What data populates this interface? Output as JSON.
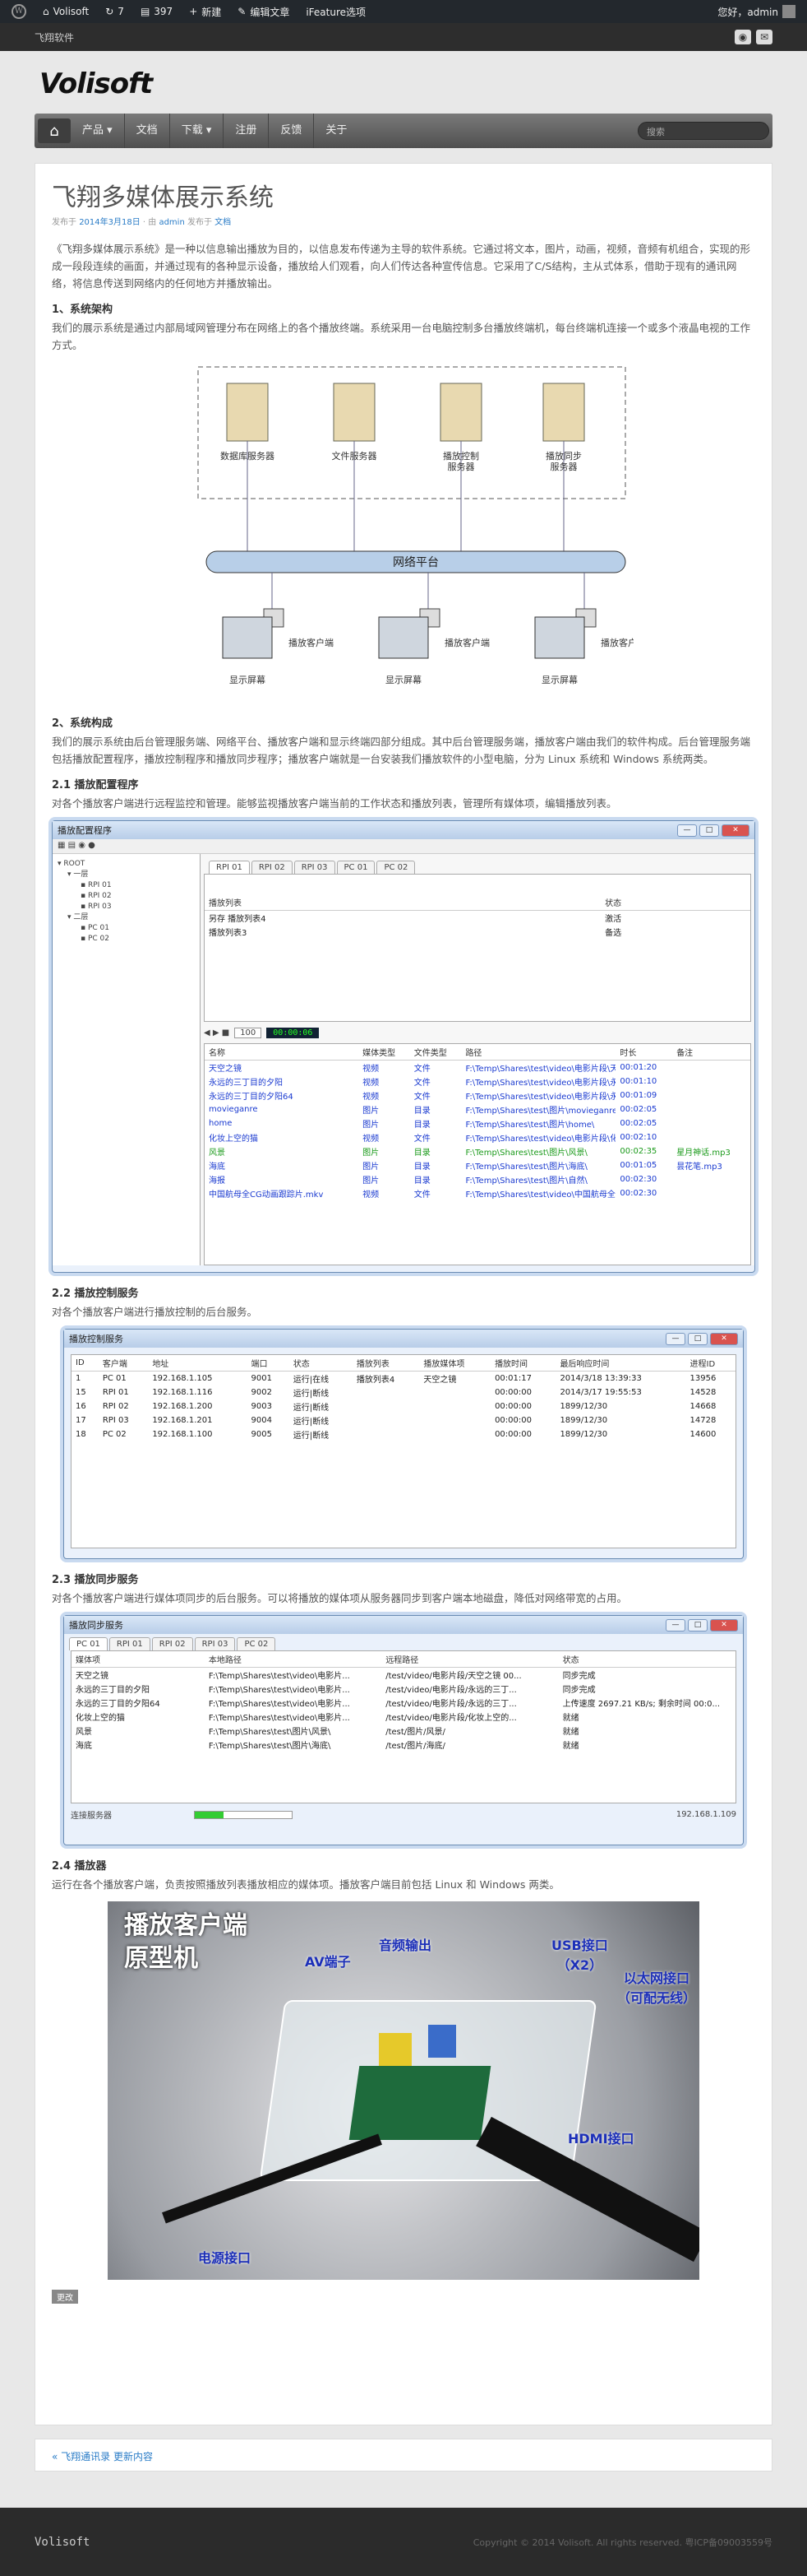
{
  "adminbar": {
    "site": "Volisoft",
    "updates": "7",
    "comments": "397",
    "new": "新建",
    "edit": "编辑文章",
    "ifeature": "iFeature选项",
    "greeting": "您好，admin"
  },
  "topbar": {
    "site_name": "飞翔软件"
  },
  "header": {
    "logo": "Volisoft"
  },
  "nav": {
    "items": [
      "产品 ▾",
      "文档",
      "下载 ▾",
      "注册",
      "反馈",
      "关于"
    ],
    "search_placeholder": "搜索"
  },
  "post": {
    "title": "飞翔多媒体展示系统",
    "meta_prefix": "发布于 ",
    "date": "2014年3月18日",
    "meta_by": " · 由 ",
    "author": "admin",
    "meta_cat": " 发布于 ",
    "category": "文档",
    "intro": "《飞翔多媒体展示系统》是一种以信息输出播放为目的，以信息发布传递为主导的软件系统。它通过将文本，图片，动画，视频，音频有机组合，实现的形成一段段连续的画面，并通过现有的各种显示设备，播放给人们观看，向人们传达各种宣传信息。它采用了C/S结构，主从式体系，借助于现有的通讯网络，将信息传送到网络内的任何地方并播放输出。",
    "s1_title": "1、系统架构",
    "s1_body": "我们的展示系统是通过内部局域网管理分布在网络上的各个播放终端。系统采用一台电脑控制多台播放终端机，每台终端机连接一个或多个液晶电视的工作方式。",
    "s2_title": "2、系统构成",
    "s2_body": "我们的展示系统由后台管理服务端、网络平台、播放客户端和显示终端四部分组成。其中后台管理服务端，播放客户端由我们的软件构成。后台管理服务端包括播放配置程序，播放控制程序和播放同步程序；播放客户端就是一台安装我们播放软件的小型电脑，分为 Linux 系统和 Windows 系统两类。",
    "s21_title": "2.1 播放配置程序",
    "s21_body": "对各个播放客户端进行远程监控和管理。能够监视播放客户端当前的工作状态和播放列表，管理所有媒体项，编辑播放列表。",
    "s22_title": "2.2 播放控制服务",
    "s22_body": "对各个播放客户端进行播放控制的后台服务。",
    "s23_title": "2.3 播放同步服务",
    "s23_body": "对各个播放客户端进行媒体项同步的后台服务。可以将播放的媒体项从服务器同步到客户端本地磁盘，降低对网络带宽的占用。",
    "s24_title": "2.4 播放器",
    "s24_body": "运行在各个播放客户端，负责按照播放列表播放相应的媒体项。播放客户端目前包括 Linux 和 Windows 两类。",
    "tag": "更改"
  },
  "diagram": {
    "servers": [
      "数据库服务器",
      "文件服务器",
      "播放控制\n服务器",
      "播放同步\n服务器"
    ],
    "network": "网络平台",
    "client": "播放客户端",
    "display": "显示屏幕"
  },
  "config_window": {
    "title": "播放配置程序",
    "tree": [
      "ROOT",
      "一层",
      "RPI 01",
      "RPI 02",
      "RPI 03",
      "二层",
      "PC 01",
      "PC 02"
    ],
    "tabs": [
      "RPI 01",
      "RPI 02",
      "RPI 03",
      "PC 01",
      "PC 02"
    ],
    "pl_headers": [
      "播放列表",
      "状态"
    ],
    "playlists": [
      [
        "另存 播放列表4",
        "激活"
      ],
      [
        "播放列表3",
        "备选"
      ]
    ],
    "time": "00:00:06",
    "page": "100",
    "media_headers": [
      "名称",
      "媒体类型",
      "文件类型",
      "路径",
      "时长",
      "备注"
    ],
    "media": [
      [
        "天空之镜",
        "视频",
        "文件",
        "F:\\Temp\\Shares\\test\\video\\电影片段\\天空之镜 00_12...",
        "00:01:20",
        ""
      ],
      [
        "永远的三丁目的夕阳",
        "视频",
        "文件",
        "F:\\Temp\\Shares\\test\\video\\电影片段\\永远的三丁目的...",
        "00:01:10",
        ""
      ],
      [
        "永远的三丁目的夕阳64",
        "视频",
        "文件",
        "F:\\Temp\\Shares\\test\\video\\电影片段\\永远的三丁目的...",
        "00:01:09",
        ""
      ],
      [
        "movieganre",
        "图片",
        "目录",
        "F:\\Temp\\Shares\\test\\图片\\movieganre\\",
        "00:02:05",
        ""
      ],
      [
        "home",
        "图片",
        "目录",
        "F:\\Temp\\Shares\\test\\图片\\home\\",
        "00:02:05",
        ""
      ],
      [
        "化妆上空的猫",
        "视频",
        "文件",
        "F:\\Temp\\Shares\\test\\video\\电影片段\\化妆上空的猫0...",
        "00:02:10",
        ""
      ],
      [
        "风景",
        "图片",
        "目录",
        "F:\\Temp\\Shares\\test\\图片\\风景\\",
        "00:02:35",
        "星月神话.mp3"
      ],
      [
        "海底",
        "图片",
        "目录",
        "F:\\Temp\\Shares\\test\\图片\\海底\\",
        "00:01:05",
        "昙花笔.mp3"
      ],
      [
        "海报",
        "图片",
        "目录",
        "F:\\Temp\\Shares\\test\\图片\\自然\\",
        "00:02:30",
        ""
      ],
      [
        "中国航母全CG动画跟踪片.mkv",
        "视频",
        "文件",
        "F:\\Temp\\Shares\\test\\video\\中国航母全CG动画跟踪片.mkv",
        "00:02:30",
        ""
      ]
    ]
  },
  "control_window": {
    "title": "播放控制服务",
    "headers": [
      "ID",
      "客户端",
      "地址",
      "端口",
      "状态",
      "播放列表",
      "播放媒体项",
      "播放时间",
      "最后响应时间",
      "进程ID"
    ],
    "rows": [
      [
        "1",
        "PC 01",
        "192.168.1.105",
        "9001",
        "运行|在线",
        "播放列表4",
        "天空之镜",
        "00:01:17",
        "2014/3/18 13:39:33",
        "13956"
      ],
      [
        "15",
        "RPI 01",
        "192.168.1.116",
        "9002",
        "运行|断线",
        "",
        "",
        "00:00:00",
        "2014/3/17 19:55:53",
        "14528"
      ],
      [
        "16",
        "RPI 02",
        "192.168.1.200",
        "9003",
        "运行|断线",
        "",
        "",
        "00:00:00",
        "1899/12/30",
        "14668"
      ],
      [
        "17",
        "RPI 03",
        "192.168.1.201",
        "9004",
        "运行|断线",
        "",
        "",
        "00:00:00",
        "1899/12/30",
        "14728"
      ],
      [
        "18",
        "PC 02",
        "192.168.1.100",
        "9005",
        "运行|断线",
        "",
        "",
        "00:00:00",
        "1899/12/30",
        "14600"
      ]
    ]
  },
  "sync_window": {
    "title": "播放同步服务",
    "tabs": [
      "PC 01",
      "RPI 01",
      "RPI 02",
      "RPI 03",
      "PC 02"
    ],
    "headers": [
      "媒体项",
      "本地路径",
      "远程路径",
      "状态"
    ],
    "rows": [
      [
        "天空之镜",
        "F:\\Temp\\Shares\\test\\video\\电影片...",
        "/test/video/电影片段/天空之镜 00...",
        "同步完成"
      ],
      [
        "永远的三丁目的夕阳",
        "F:\\Temp\\Shares\\test\\video\\电影片...",
        "/test/video/电影片段/永远的三丁...",
        "同步完成"
      ],
      [
        "永远的三丁目的夕阳64",
        "F:\\Temp\\Shares\\test\\video\\电影片...",
        "/test/video/电影片段/永远的三丁...",
        "上传速度 2697.21 KB/s; 剩余时间 00:0..."
      ],
      [
        "化妆上空的猫",
        "F:\\Temp\\Shares\\test\\video\\电影片...",
        "/test/video/电影片段/化妆上空的...",
        "就绪"
      ],
      [
        "风景",
        "F:\\Temp\\Shares\\test\\图片\\风景\\",
        "/test/图片/风景/",
        "就绪"
      ],
      [
        "海底",
        "F:\\Temp\\Shares\\test\\图片\\海底\\",
        "/test/图片/海底/",
        "就绪"
      ]
    ],
    "connect": "连接服务器",
    "progress": 0.3,
    "ip": "192.168.1.109"
  },
  "photo": {
    "title": "播放客户端\n原型机",
    "av": "AV端子",
    "audio": "音频输出",
    "usb": "USB接口\n（X2）",
    "eth": "以太网接口\n（可配无线）",
    "hdmi": "HDMI接口",
    "power": "电源接口"
  },
  "postnav": {
    "prev": "« 飞翔通讯录 更新内容"
  },
  "footer": {
    "logo": "Volisoft",
    "copyright": "Copyright © 2014 Volisoft. All rights reserved. 粤ICP备09003559号"
  }
}
